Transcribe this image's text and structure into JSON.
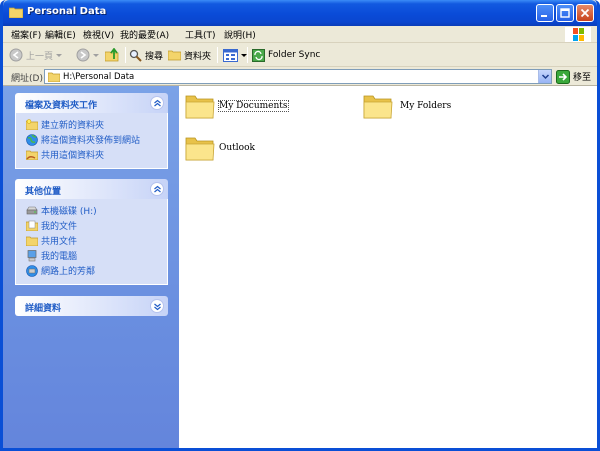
{
  "window": {
    "title": "Personal Data"
  },
  "menu": [
    "檔案(F)",
    "編輯(E)",
    "檢視(V)",
    "我的最愛(A)",
    "工具(T)",
    "說明(H)"
  ],
  "toolbar": {
    "back_label": "上一頁",
    "search_label": "搜尋",
    "folders_label": "資料夾",
    "sync_label": "Folder Sync"
  },
  "address": {
    "label": "網址(D)",
    "value": "H:\\Personal Data",
    "go_label": "移至"
  },
  "panels": {
    "tasks": {
      "title": "檔案及資料夾工作",
      "items": [
        "建立新的資料夾",
        "將這個資料夾發佈到網站",
        "共用這個資料夾"
      ]
    },
    "places": {
      "title": "其他位置",
      "items": [
        "本機磁碟 (H:)",
        "我的文件",
        "共用文件",
        "我的電腦",
        "網路上的芳鄰"
      ]
    },
    "details": {
      "title": "詳細資料"
    }
  },
  "folders": [
    "My Documents",
    "My Folders",
    "Outlook"
  ],
  "colors": {
    "titlebar": "#0a4bd8",
    "taskpane": "#6a8fe0",
    "panel_link": "#215dc6"
  }
}
